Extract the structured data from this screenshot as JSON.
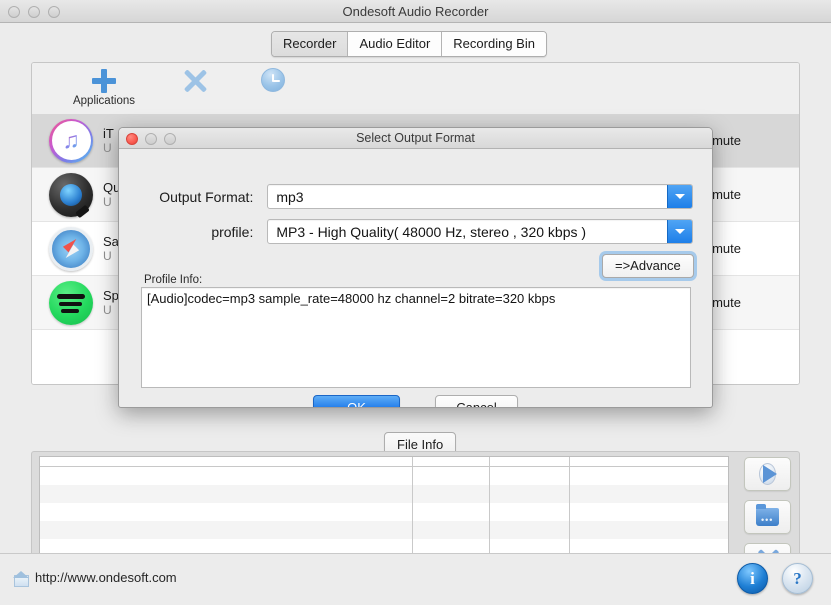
{
  "window": {
    "title": "Ondesoft Audio Recorder",
    "traffic_lights": [
      "close",
      "minimize",
      "zoom"
    ]
  },
  "tabs": [
    {
      "label": "Recorder",
      "active": true
    },
    {
      "label": "Audio Editor",
      "active": false
    },
    {
      "label": "Recording Bin",
      "active": false
    }
  ],
  "toolbar": {
    "items": [
      {
        "label": "Applications",
        "icon": "plus-icon"
      },
      {
        "label": "",
        "icon": "x-icon"
      },
      {
        "label": "",
        "icon": "clock-icon"
      }
    ]
  },
  "applications": {
    "mute_label": "mute",
    "rows": [
      {
        "name": "iT",
        "sub": "U",
        "icon": "itunes-icon",
        "muted": false,
        "selected": true
      },
      {
        "name": "Qu",
        "sub": "U",
        "icon": "quicktime-icon",
        "muted": false,
        "selected": false
      },
      {
        "name": "Sa",
        "sub": "U",
        "icon": "safari-icon",
        "muted": false,
        "selected": false
      },
      {
        "name": "Sp",
        "sub": "U",
        "icon": "spotify-icon",
        "muted": false,
        "selected": false
      }
    ]
  },
  "file_info": {
    "tab_label": "File Info",
    "columns": [
      "",
      "",
      "",
      ""
    ],
    "rows": [],
    "side_buttons": [
      {
        "name": "play-button",
        "icon": "play-icon"
      },
      {
        "name": "open-folder-button",
        "icon": "folder-icon"
      },
      {
        "name": "delete-button",
        "icon": "close-x-icon"
      }
    ]
  },
  "footer": {
    "url": "http://www.ondesoft.com",
    "info_glyph": "i",
    "help_glyph": "?"
  },
  "dialog": {
    "title": "Select Output Format",
    "output_format": {
      "label": "Output Format:",
      "value": "mp3"
    },
    "profile": {
      "label": "profile:",
      "value": "MP3 - High Quality( 48000 Hz, stereo , 320 kbps  )"
    },
    "advance_button": "=>Advance",
    "profile_info": {
      "label": "Profile Info:",
      "text": "[Audio]codec=mp3 sample_rate=48000 hz channel=2 bitrate=320 kbps"
    },
    "ok_button": "OK",
    "cancel_button": "Cancel"
  },
  "colors": {
    "accent_blue": "#1f7de8",
    "window_bg": "#ececec",
    "selected_row": "#d7d7d7"
  }
}
